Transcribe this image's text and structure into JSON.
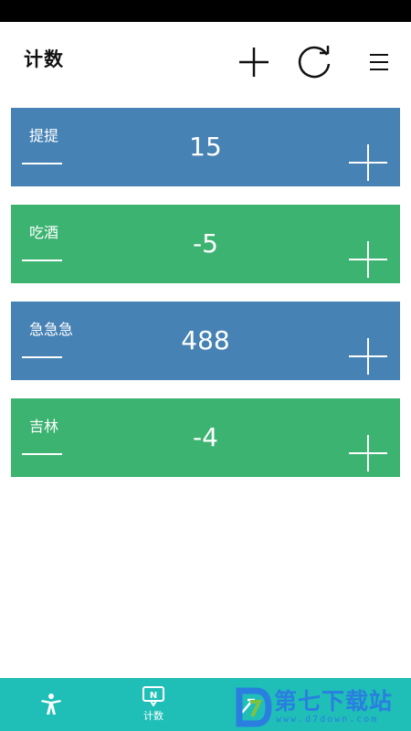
{
  "header": {
    "title": "计数"
  },
  "counters": [
    {
      "name": "提提",
      "value": "15",
      "color": "#4682b4"
    },
    {
      "name": "吃酒",
      "value": "-5",
      "color": "#3cb371"
    },
    {
      "name": "急急急",
      "value": "488",
      "color": "#4682b4"
    },
    {
      "name": "吉林",
      "value": "-4",
      "color": "#3cb371"
    }
  ],
  "bottom_nav": {
    "items": [
      {
        "icon": "person-icon",
        "label": ""
      },
      {
        "icon": "counter-icon",
        "label": "计数"
      },
      {
        "icon": "tool-icon",
        "label": ""
      }
    ]
  },
  "watermark": {
    "brand": "第七下载站",
    "url": "www.d7down.com",
    "color": "#2a7ee0"
  },
  "colors": {
    "status_bar": "#000000",
    "blue_card": "#4682b4",
    "green_card": "#3cb371",
    "nav_bar": "#1fbfb8"
  }
}
